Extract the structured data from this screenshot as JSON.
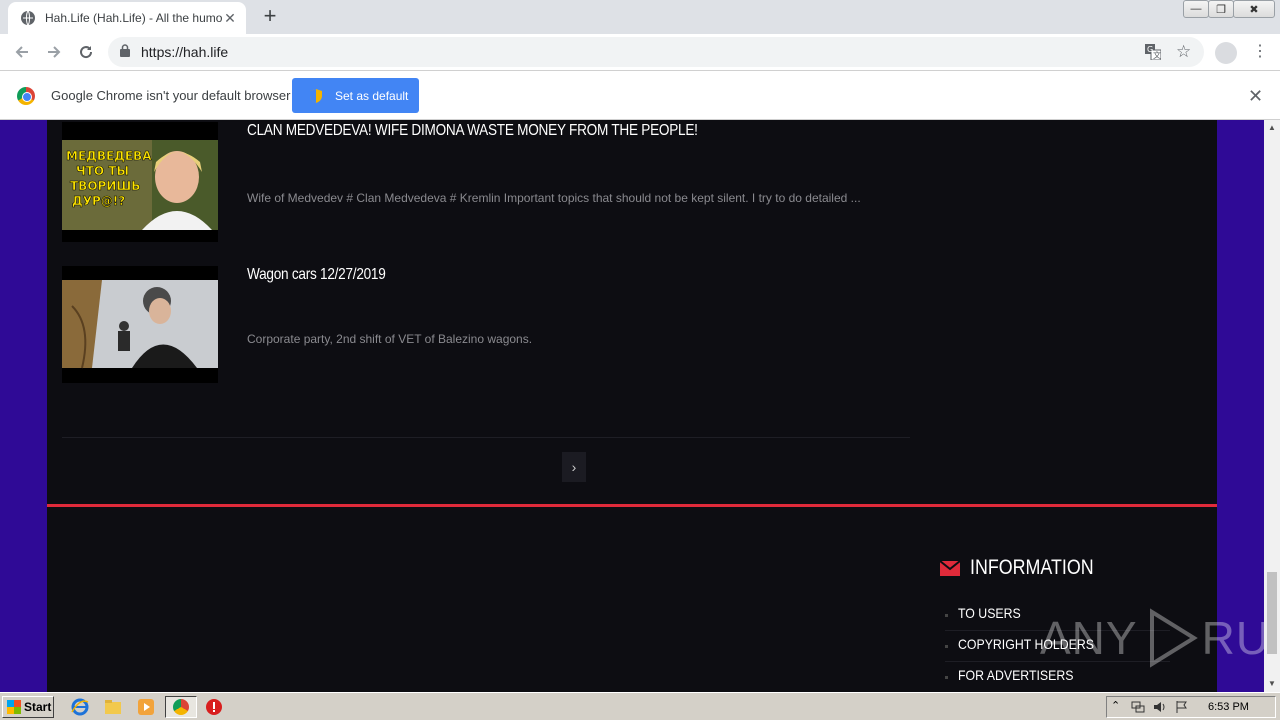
{
  "browser": {
    "tab_title": "Hah.Life (Hah.Life) - All the humor in",
    "url": "https://hah.life",
    "window_controls": {
      "minimize": "—",
      "maximize": "❐",
      "close": "✖"
    }
  },
  "infobar": {
    "message": "Google Chrome isn't your default browser",
    "button_label": "Set as default"
  },
  "posts": [
    {
      "title": "CLAN MEDVEDEVA! WIFE DIMONA WASTE MONEY FROM THE PEOPLE!",
      "description": "Wife of Medvedev # Clan Medvedeva # Kremlin Important topics that should not be kept silent. I try to do detailed ...",
      "thumb_caption": "МЕДВЕДЕВА ЧТО ТЫ ТВОРИШЬ ДУР@!?"
    },
    {
      "title": "Wagon cars 12/27/2019",
      "description": "Corporate party, 2nd shift of VET of Balezino wagons."
    }
  ],
  "pagination": {
    "next_label": "›"
  },
  "footer": {
    "info_heading": "INFORMATION",
    "links": [
      "TO USERS",
      "COPYRIGHT HOLDERS",
      "FOR ADVERTISERS"
    ],
    "accent_color": "#e02a3a"
  },
  "watermark": {
    "text_left": "ANY",
    "text_right": "RUN"
  },
  "taskbar": {
    "start_label": "Start",
    "clock": "6:53 PM"
  }
}
